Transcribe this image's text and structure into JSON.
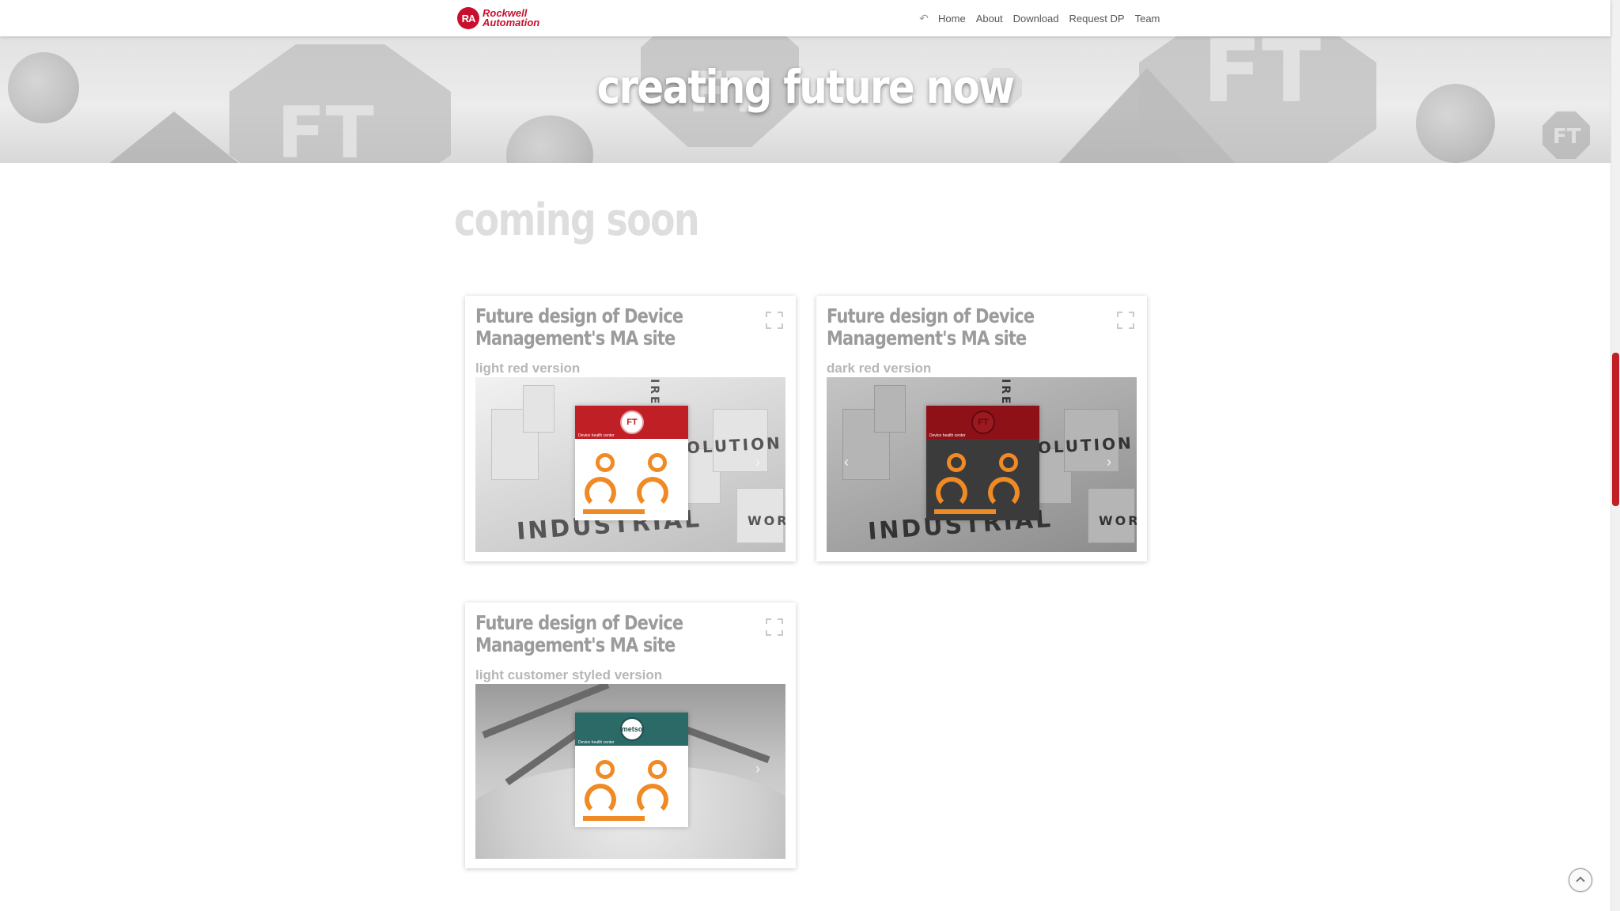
{
  "brand": {
    "logo_badge": "RA",
    "logo_line1": "Rockwell",
    "logo_line2": "Automation",
    "accent_color": "#c8102e"
  },
  "nav": {
    "back_icon": "back-arrow-icon",
    "items": [
      {
        "label": "Home"
      },
      {
        "label": "About"
      },
      {
        "label": "Download"
      },
      {
        "label": "Request DP"
      },
      {
        "label": "Team"
      }
    ]
  },
  "hero": {
    "title": "creating future now",
    "watermark": "FT"
  },
  "section": {
    "title": "coming soon"
  },
  "cards": [
    {
      "title": "Future design of Device Management's MA site",
      "subtitle": "light red version",
      "expand_icon": "expand-icon",
      "preview": {
        "logo": "FT",
        "panel_label": "Device health center",
        "words": [
          "INDUSTRIAL",
          "EVOLUTION",
          "WOR",
          "IRE"
        ]
      }
    },
    {
      "title": "Future design of Device Management's MA site",
      "subtitle": "dark red version",
      "expand_icon": "expand-icon",
      "preview": {
        "logo": "FT",
        "panel_label": "Device health center",
        "words": [
          "INDUSTRIAL",
          "EVOLUTION",
          "WOR",
          "IRE"
        ]
      }
    },
    {
      "title": "Future design of Device Management's MA site",
      "subtitle": "light customer styled version",
      "expand_icon": "expand-icon",
      "preview": {
        "logo": "metso",
        "panel_label": "Device health center"
      }
    }
  ],
  "colors": {
    "light_red": "#c01f25",
    "dark_red": "#8f1118",
    "teal": "#2b6a67",
    "gauge_orange": "#f08a24",
    "scroll_thumb": "#c01f25"
  },
  "scroll_to_top_icon": "chevron-up-icon"
}
